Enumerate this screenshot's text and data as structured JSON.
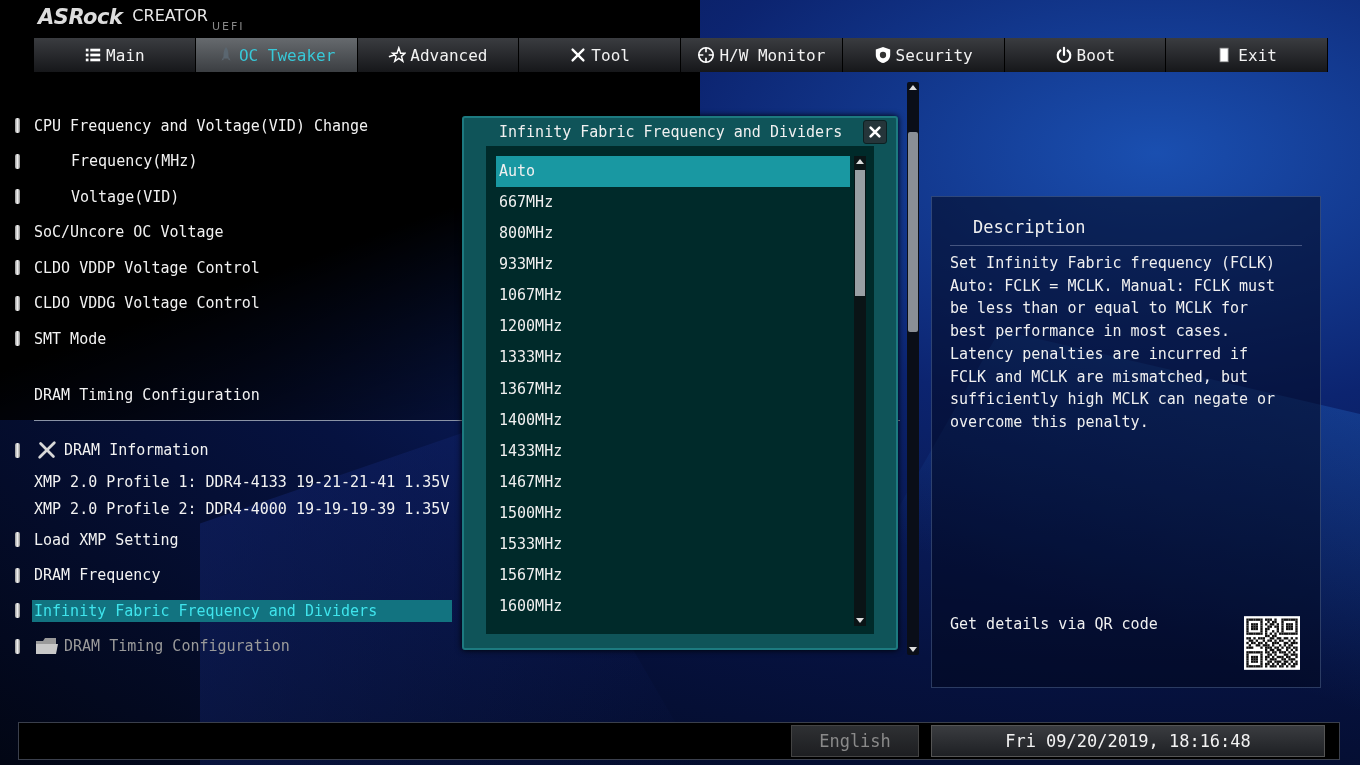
{
  "logo": {
    "brand": "ASRock",
    "product": "CREATOR",
    "edition": "UEFI"
  },
  "tabs": [
    {
      "label": "Main",
      "selected": false
    },
    {
      "label": "OC Tweaker",
      "selected": true
    },
    {
      "label": "Advanced",
      "selected": false
    },
    {
      "label": "Tool",
      "selected": false
    },
    {
      "label": "H/W Monitor",
      "selected": false
    },
    {
      "label": "Security",
      "selected": false
    },
    {
      "label": "Boot",
      "selected": false
    },
    {
      "label": "Exit",
      "selected": false
    }
  ],
  "menu": [
    {
      "kind": "setting",
      "label": "CPU Frequency and Voltage(VID) Change",
      "selected": false,
      "disabled": false
    },
    {
      "kind": "sub-setting",
      "label": "Frequency(MHz)",
      "selected": false,
      "disabled": false
    },
    {
      "kind": "sub-setting",
      "label": "Voltage(VID)",
      "selected": false,
      "disabled": false
    },
    {
      "kind": "setting",
      "label": "SoC/Uncore OC Voltage",
      "selected": false,
      "disabled": false
    },
    {
      "kind": "setting",
      "label": "CLDO VDDP Voltage Control",
      "selected": false,
      "disabled": false
    },
    {
      "kind": "setting",
      "label": "CLDO VDDG Voltage Control",
      "selected": false,
      "disabled": false
    },
    {
      "kind": "setting",
      "label": "SMT Mode",
      "selected": false,
      "disabled": false
    },
    {
      "kind": "heading",
      "label": "DRAM Timing Configuration",
      "selected": false,
      "disabled": false
    },
    {
      "kind": "tool",
      "label": "DRAM Information",
      "selected": false,
      "disabled": false
    },
    {
      "kind": "info",
      "label": "XMP 2.0 Profile 1: DDR4-4133 19-21-21-41 1.35V",
      "selected": false,
      "disabled": false
    },
    {
      "kind": "info",
      "label": "XMP 2.0 Profile 2: DDR4-4000 19-19-19-39 1.35V",
      "selected": false,
      "disabled": false
    },
    {
      "kind": "setting",
      "label": "Load XMP Setting",
      "selected": false,
      "disabled": false
    },
    {
      "kind": "setting",
      "label": "DRAM Frequency",
      "selected": false,
      "disabled": false
    },
    {
      "kind": "setting",
      "label": "Infinity Fabric Frequency and Dividers",
      "selected": true,
      "disabled": false
    },
    {
      "kind": "submenu",
      "label": "DRAM Timing Configuration",
      "selected": false,
      "disabled": true
    }
  ],
  "popup": {
    "title": "Infinity Fabric Frequency and Dividers",
    "options": [
      {
        "label": "Auto",
        "selected": true
      },
      {
        "label": "667MHz",
        "selected": false
      },
      {
        "label": "800MHz",
        "selected": false
      },
      {
        "label": "933MHz",
        "selected": false
      },
      {
        "label": "1067MHz",
        "selected": false
      },
      {
        "label": "1200MHz",
        "selected": false
      },
      {
        "label": "1333MHz",
        "selected": false
      },
      {
        "label": "1367MHz",
        "selected": false
      },
      {
        "label": "1400MHz",
        "selected": false
      },
      {
        "label": "1433MHz",
        "selected": false
      },
      {
        "label": "1467MHz",
        "selected": false
      },
      {
        "label": "1500MHz",
        "selected": false
      },
      {
        "label": "1533MHz",
        "selected": false
      },
      {
        "label": "1567MHz",
        "selected": false
      },
      {
        "label": "1600MHz",
        "selected": false
      }
    ]
  },
  "description": {
    "title": "Description",
    "text": "Set Infinity Fabric frequency (FCLK) Auto: FCLK = MCLK. Manual: FCLK must be less than or equal to MCLK for best performance in most cases. Latency penalties are incurred if FCLK and MCLK are mismatched, but sufficiently high MCLK can negate or overcome this penalty.",
    "qr_label": "Get details via QR code"
  },
  "status_bar": {
    "language": "English",
    "datetime": "Fri 09/20/2019, 18:16:48"
  }
}
